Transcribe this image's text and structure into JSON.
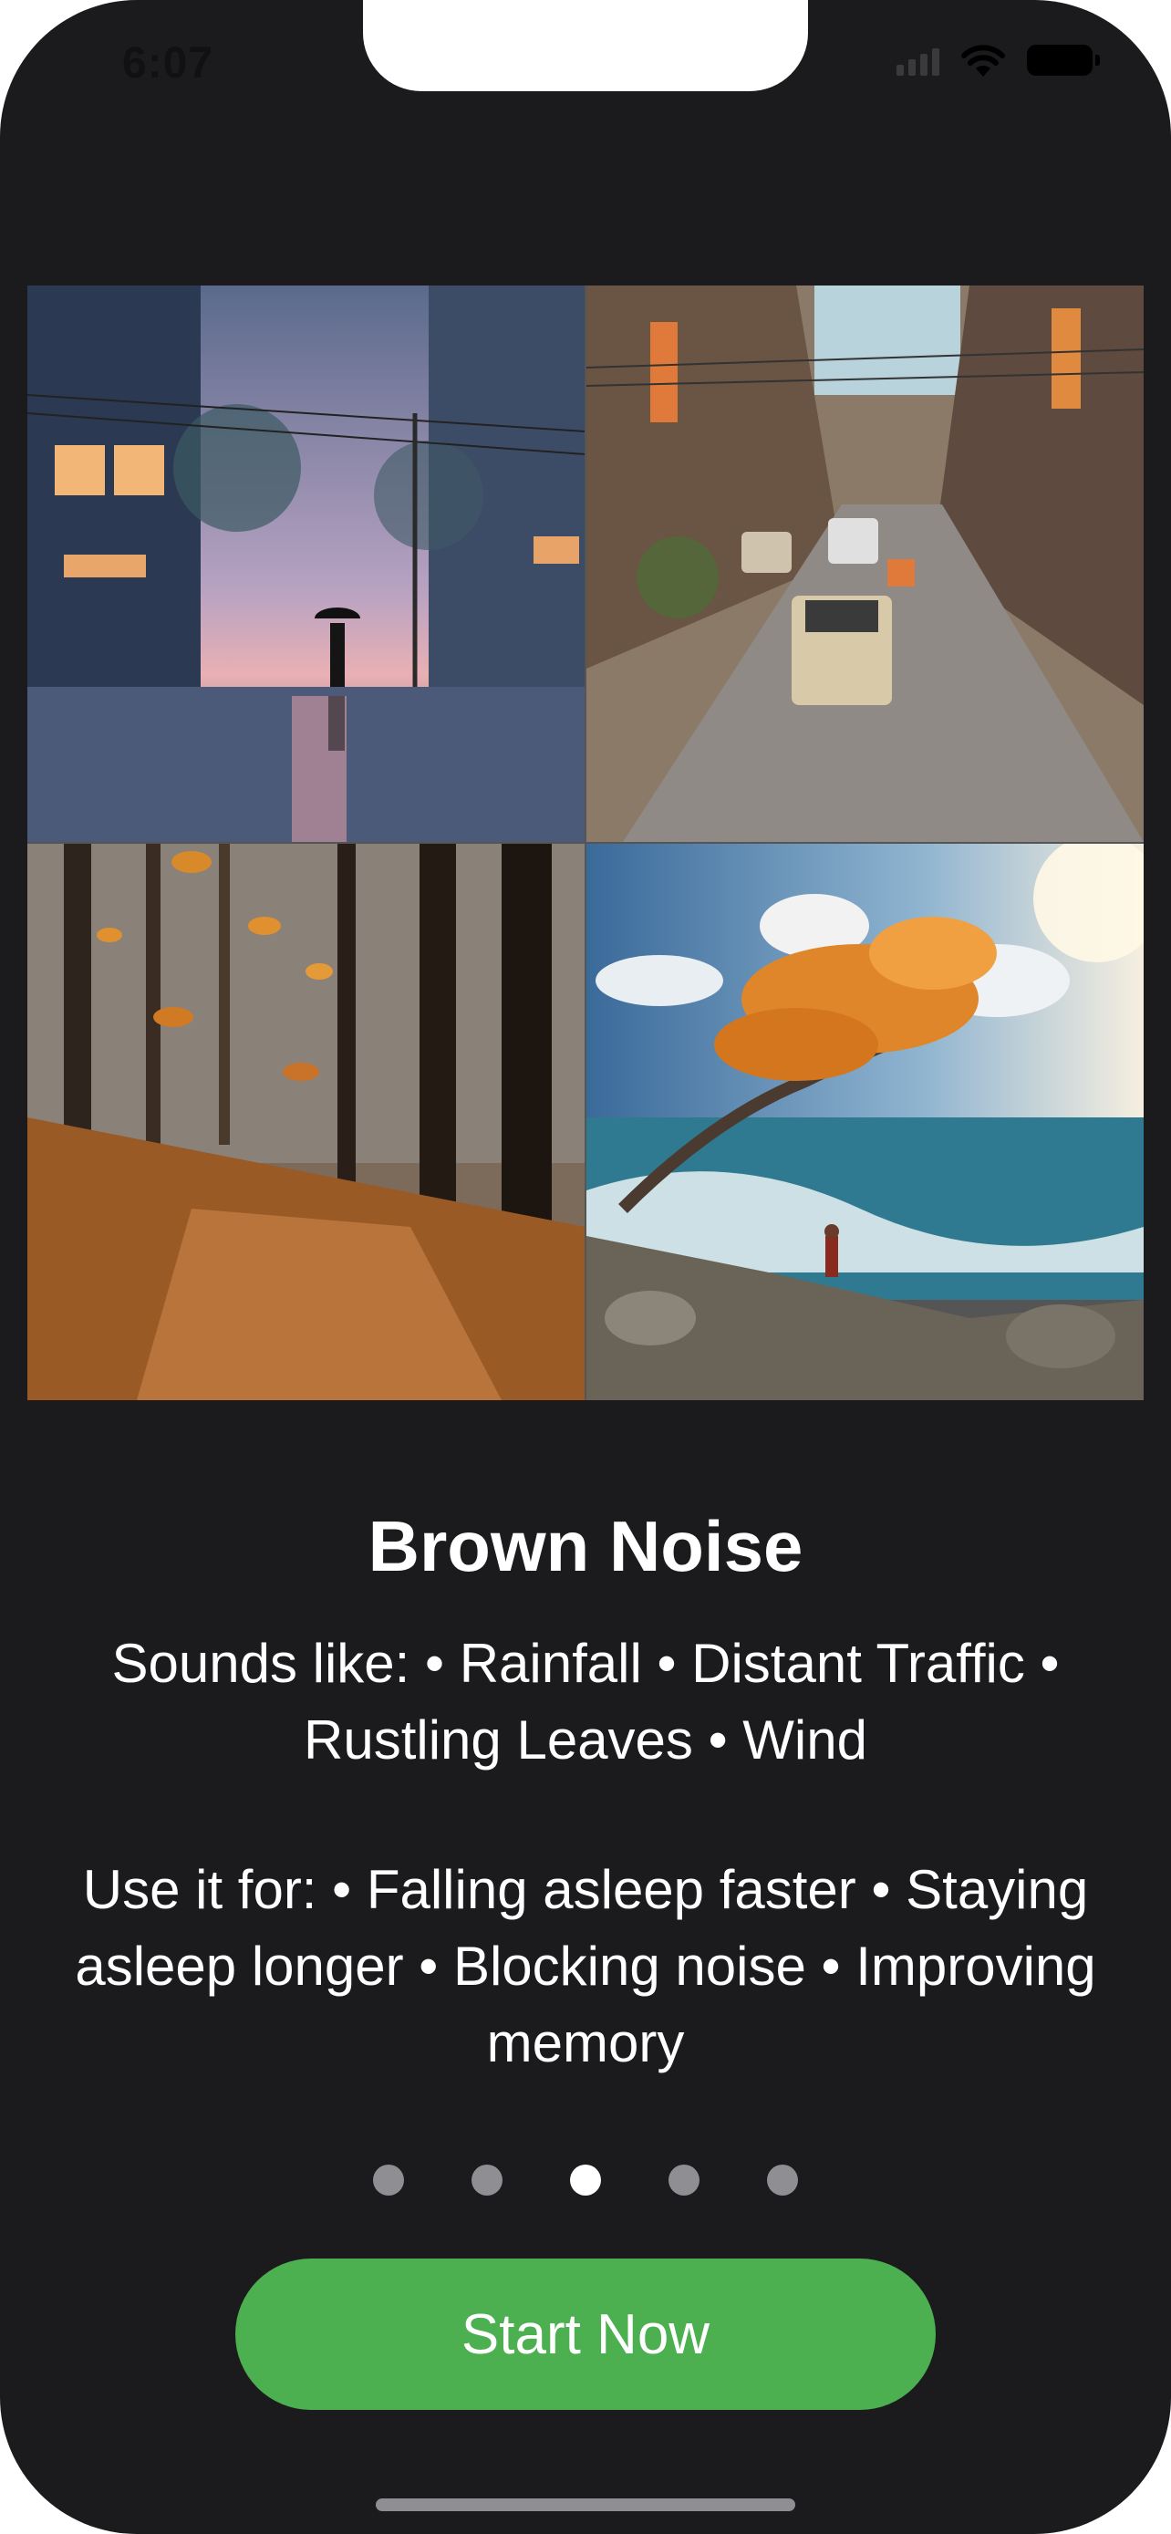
{
  "status_bar": {
    "time": "6:07",
    "icons": [
      "signal-icon",
      "wifi-icon",
      "battery-icon"
    ]
  },
  "hero": {
    "tiles": [
      {
        "name": "rain-street-image",
        "icon": "rainfall-scene"
      },
      {
        "name": "traffic-street-image",
        "icon": "traffic-scene"
      },
      {
        "name": "forest-leaves-image",
        "icon": "leaves-scene"
      },
      {
        "name": "windy-coast-image",
        "icon": "wind-scene"
      }
    ]
  },
  "content": {
    "title": "Brown Noise",
    "sounds_like": "Sounds like: • Rainfall • Distant Traffic • Rustling Leaves • Wind",
    "use_it_for": "Use it for: • Falling asleep faster • Staying asleep longer • Blocking noise • Improving memory"
  },
  "pager": {
    "count": 5,
    "active": 3
  },
  "cta": {
    "label": "Start Now"
  },
  "colors": {
    "background": "#1b1b1e",
    "accent": "#4caf50",
    "dot_inactive": "#8e8e93",
    "dot_active": "#ffffff"
  }
}
